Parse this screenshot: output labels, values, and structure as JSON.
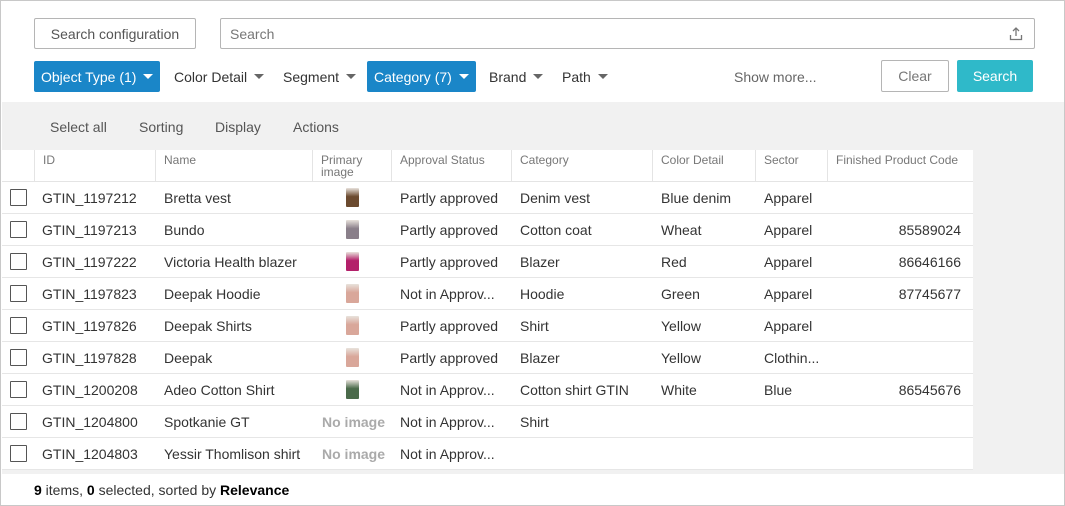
{
  "top_bar": {
    "search_config_label": "Search configuration",
    "search_placeholder": "Search",
    "search_value": "",
    "upload_icon": "upload-icon"
  },
  "filters": [
    {
      "label": "Object Type (1)",
      "active": true
    },
    {
      "label": "Color Detail",
      "active": false
    },
    {
      "label": "Segment",
      "active": false
    },
    {
      "label": "Category (7)",
      "active": true
    },
    {
      "label": "Brand",
      "active": false
    },
    {
      "label": "Path",
      "active": false
    }
  ],
  "filter_actions": {
    "show_more": "Show more...",
    "clear": "Clear",
    "search": "Search"
  },
  "toolbar": {
    "select_all": "Select all",
    "sorting": "Sorting",
    "display": "Display",
    "actions": "Actions"
  },
  "table": {
    "headers": {
      "id": "ID",
      "name": "Name",
      "primary_image": "Primary image",
      "approval_status": "Approval Status",
      "category": "Category",
      "color_detail": "Color Detail",
      "sector": "Sector",
      "finished_product_code": "Finished Product Code"
    },
    "rows": [
      {
        "id": "GTIN_1197212",
        "name": "Bretta vest",
        "image": "thumb",
        "image_color": "#6b4a2f",
        "approval": "Partly approved",
        "category": "Denim vest",
        "color": "Blue denim",
        "sector": "Apparel",
        "code": ""
      },
      {
        "id": "GTIN_1197213",
        "name": "Bundo",
        "image": "thumb",
        "image_color": "#8a7f8a",
        "approval": "Partly approved",
        "category": "Cotton coat",
        "color": "Wheat",
        "sector": "Apparel",
        "code": "85589024"
      },
      {
        "id": "GTIN_1197222",
        "name": "Victoria Health blazer",
        "image": "thumb",
        "image_color": "#b3206a",
        "approval": "Partly approved",
        "category": "Blazer",
        "color": "Red",
        "sector": "Apparel",
        "code": "86646166"
      },
      {
        "id": "GTIN_1197823",
        "name": "Deepak Hoodie",
        "image": "thumb",
        "image_color": "#d9a79a",
        "approval": "Not in Approv...",
        "category": "Hoodie",
        "color": "Green",
        "sector": "Apparel",
        "code": "87745677"
      },
      {
        "id": "GTIN_1197826",
        "name": "Deepak Shirts",
        "image": "thumb",
        "image_color": "#d9a79a",
        "approval": "Partly approved",
        "category": "Shirt",
        "color": "Yellow",
        "sector": "Apparel",
        "code": ""
      },
      {
        "id": "GTIN_1197828",
        "name": "Deepak",
        "image": "thumb",
        "image_color": "#d9a79a",
        "approval": "Partly approved",
        "category": "Blazer",
        "color": "Yellow",
        "sector": "Clothin...",
        "code": ""
      },
      {
        "id": "GTIN_1200208",
        "name": "Adeo Cotton Shirt",
        "image": "thumb",
        "image_color": "#4a6a4a",
        "approval": "Not in Approv...",
        "category": "Cotton shirt GTIN",
        "color": "White",
        "sector": "Blue",
        "code": "86545676"
      },
      {
        "id": "GTIN_1204800",
        "name": "Spotkanie GT",
        "image": "none",
        "no_image_label": "No image",
        "approval": "Not in Approv...",
        "category": "Shirt",
        "color": "",
        "sector": "",
        "code": ""
      },
      {
        "id": "GTIN_1204803",
        "name": "Yessir Thomlison shirt",
        "image": "none",
        "no_image_label": "No image",
        "approval": "Not in Approv...",
        "category": "",
        "color": "",
        "sector": "",
        "code": ""
      }
    ]
  },
  "footer": {
    "count": "9",
    "items_text": " items, ",
    "selected": "0",
    "selected_text": " selected, sorted by ",
    "sort": "Relevance"
  },
  "colors": {
    "active_filter": "#1a86c8",
    "search_button": "#2fb9c9",
    "gray_background": "#f1f1f1"
  }
}
